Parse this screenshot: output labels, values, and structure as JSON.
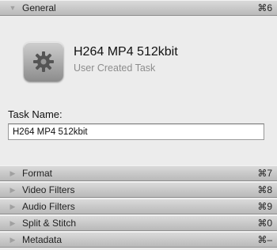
{
  "sections": [
    {
      "label": "General",
      "shortcut": "⌘6",
      "expanded": true
    },
    {
      "label": "Format",
      "shortcut": "⌘7",
      "expanded": false
    },
    {
      "label": "Video Filters",
      "shortcut": "⌘8",
      "expanded": false
    },
    {
      "label": "Audio Filters",
      "shortcut": "⌘9",
      "expanded": false
    },
    {
      "label": "Split & Stitch",
      "shortcut": "⌘0",
      "expanded": false
    },
    {
      "label": "Metadata",
      "shortcut": "⌘–",
      "expanded": false
    }
  ],
  "general": {
    "icon": "gear-icon",
    "title": "H264 MP4 512kbit",
    "subtitle": "User Created Task",
    "task_name_label": "Task Name:",
    "task_name_value": "H264 MP4 512kbit"
  },
  "icons": {
    "expanded": "disclosure-triangle-down-icon",
    "collapsed": "disclosure-triangle-right-icon"
  },
  "colors": {
    "header_top": "#dadada",
    "header_bottom": "#b9b9b9",
    "panel_bg": "#ececec",
    "subtitle": "#8d8d8d"
  }
}
